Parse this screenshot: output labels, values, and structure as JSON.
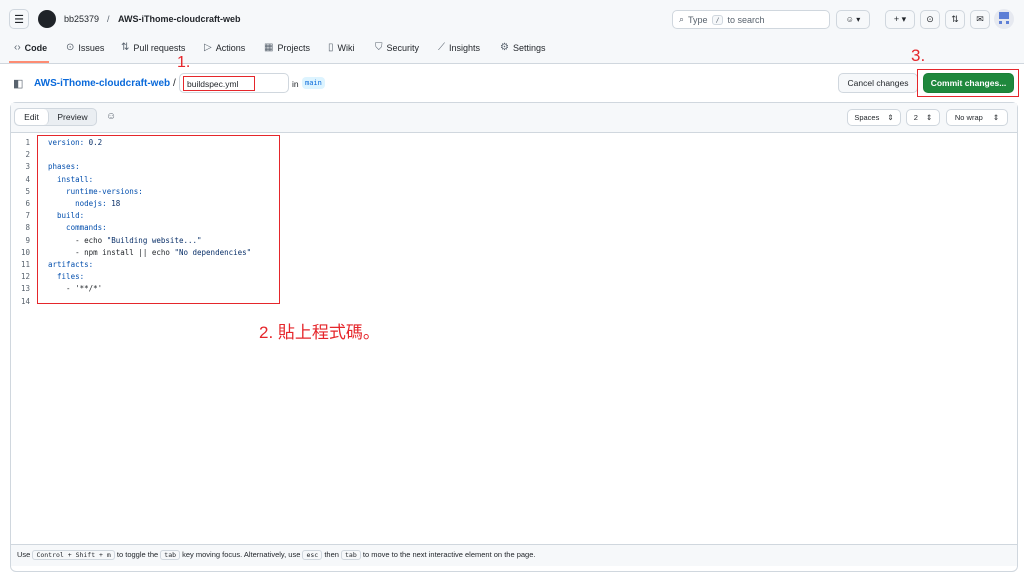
{
  "header": {
    "owner": "bb25379",
    "separator": "/",
    "repo": "AWS-iThome-cloudcraft-web",
    "search_placeholder_pre": "Type",
    "search_key": "/",
    "search_placeholder_post": "to search"
  },
  "tabs": [
    {
      "label": "Code",
      "icon": "code-icon",
      "active": true
    },
    {
      "label": "Issues",
      "icon": "issue-icon"
    },
    {
      "label": "Pull requests",
      "icon": "pull-request-icon"
    },
    {
      "label": "Actions",
      "icon": "play-icon"
    },
    {
      "label": "Projects",
      "icon": "table-icon"
    },
    {
      "label": "Wiki",
      "icon": "book-icon"
    },
    {
      "label": "Security",
      "icon": "shield-icon"
    },
    {
      "label": "Insights",
      "icon": "graph-icon"
    },
    {
      "label": "Settings",
      "icon": "gear-icon"
    }
  ],
  "file": {
    "repo": "AWS-iThome-cloudcraft-web",
    "sep": "/",
    "filename": "buildspec.yml",
    "in": "in",
    "branch": "main",
    "cancel": "Cancel changes",
    "commit": "Commit changes..."
  },
  "editor": {
    "edit": "Edit",
    "preview": "Preview",
    "indent_mode": "Spaces",
    "indent_size": "2",
    "wrap": "No wrap",
    "lines": [
      [
        "version:",
        " 0.2"
      ],
      [
        "",
        ""
      ],
      [
        "phases:",
        ""
      ],
      [
        "  install:",
        ""
      ],
      [
        "    runtime-versions:",
        ""
      ],
      [
        "      nodejs:",
        " 18"
      ],
      [
        "  build:",
        ""
      ],
      [
        "    commands:",
        ""
      ],
      [
        "      - echo ",
        "\"Building website...\""
      ],
      [
        "      - npm install || echo ",
        "\"No dependencies\""
      ],
      [
        "artifacts:",
        ""
      ],
      [
        "  files:",
        ""
      ],
      [
        "    - '**/*'",
        ""
      ],
      [
        "",
        ""
      ]
    ]
  },
  "annotations": {
    "step1": "1.",
    "step2": "2. 貼上程式碼。",
    "step3": "3."
  },
  "footer": {
    "t1": "Use",
    "k1": "Control + Shift + m",
    "t2": "to toggle the",
    "k2": "tab",
    "t3": "key moving focus. Alternatively, use",
    "k3": "esc",
    "t4": "then",
    "k4": "tab",
    "t5": "to move to the next interactive element on the page."
  },
  "colors": {
    "accent": "#1f883d",
    "link": "#0969da",
    "annotation": "#e5262b"
  }
}
